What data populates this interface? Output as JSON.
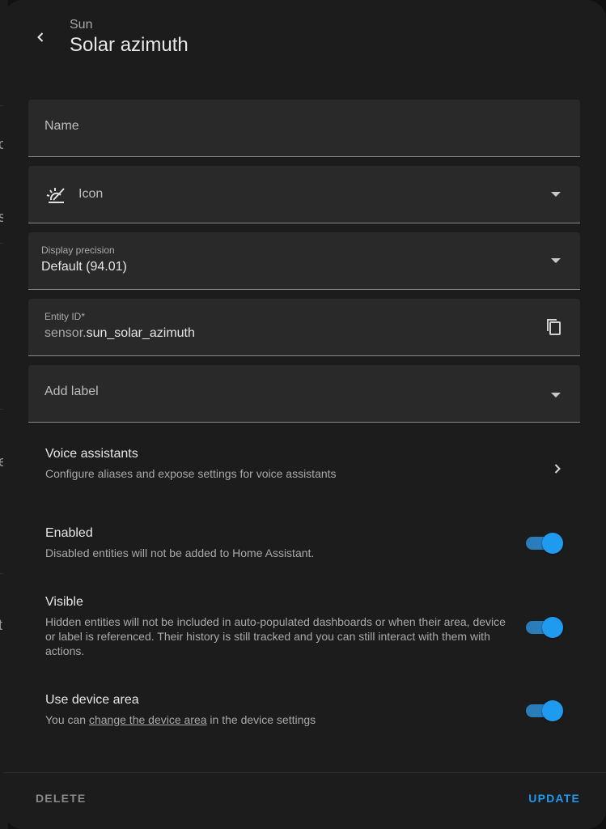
{
  "header": {
    "subtitle": "Sun",
    "title": "Solar azimuth"
  },
  "fields": {
    "name": {
      "label": "Name"
    },
    "icon": {
      "label": "Icon",
      "icon_name": "sun-angle-icon"
    },
    "display_precision": {
      "label": "Display precision",
      "value": "Default (94.01)"
    },
    "entity_id": {
      "label": "Entity ID*",
      "prefix": "sensor.",
      "value": "sun_solar_azimuth"
    },
    "add_label": {
      "label": "Add label"
    }
  },
  "voice_assistants": {
    "title": "Voice assistants",
    "description": "Configure aliases and expose settings for voice assistants"
  },
  "enabled": {
    "title": "Enabled",
    "description": "Disabled entities will not be added to Home Assistant.",
    "on": true
  },
  "visible": {
    "title": "Visible",
    "description": "Hidden entities will not be included in auto-populated dashboards or when their area, device or label is referenced. Their history is still tracked and you can still interact with them with actions.",
    "on": true
  },
  "use_device_area": {
    "title": "Use device area",
    "desc_before": "You can ",
    "link": "change the device area",
    "desc_after": " in the device settings",
    "on": true
  },
  "footer": {
    "delete_label": "DELETE",
    "update_label": "UPDATE"
  },
  "colors": {
    "accent": "#1e9bef",
    "dialog_bg": "#1c1c1c",
    "field_bg": "#292929"
  }
}
